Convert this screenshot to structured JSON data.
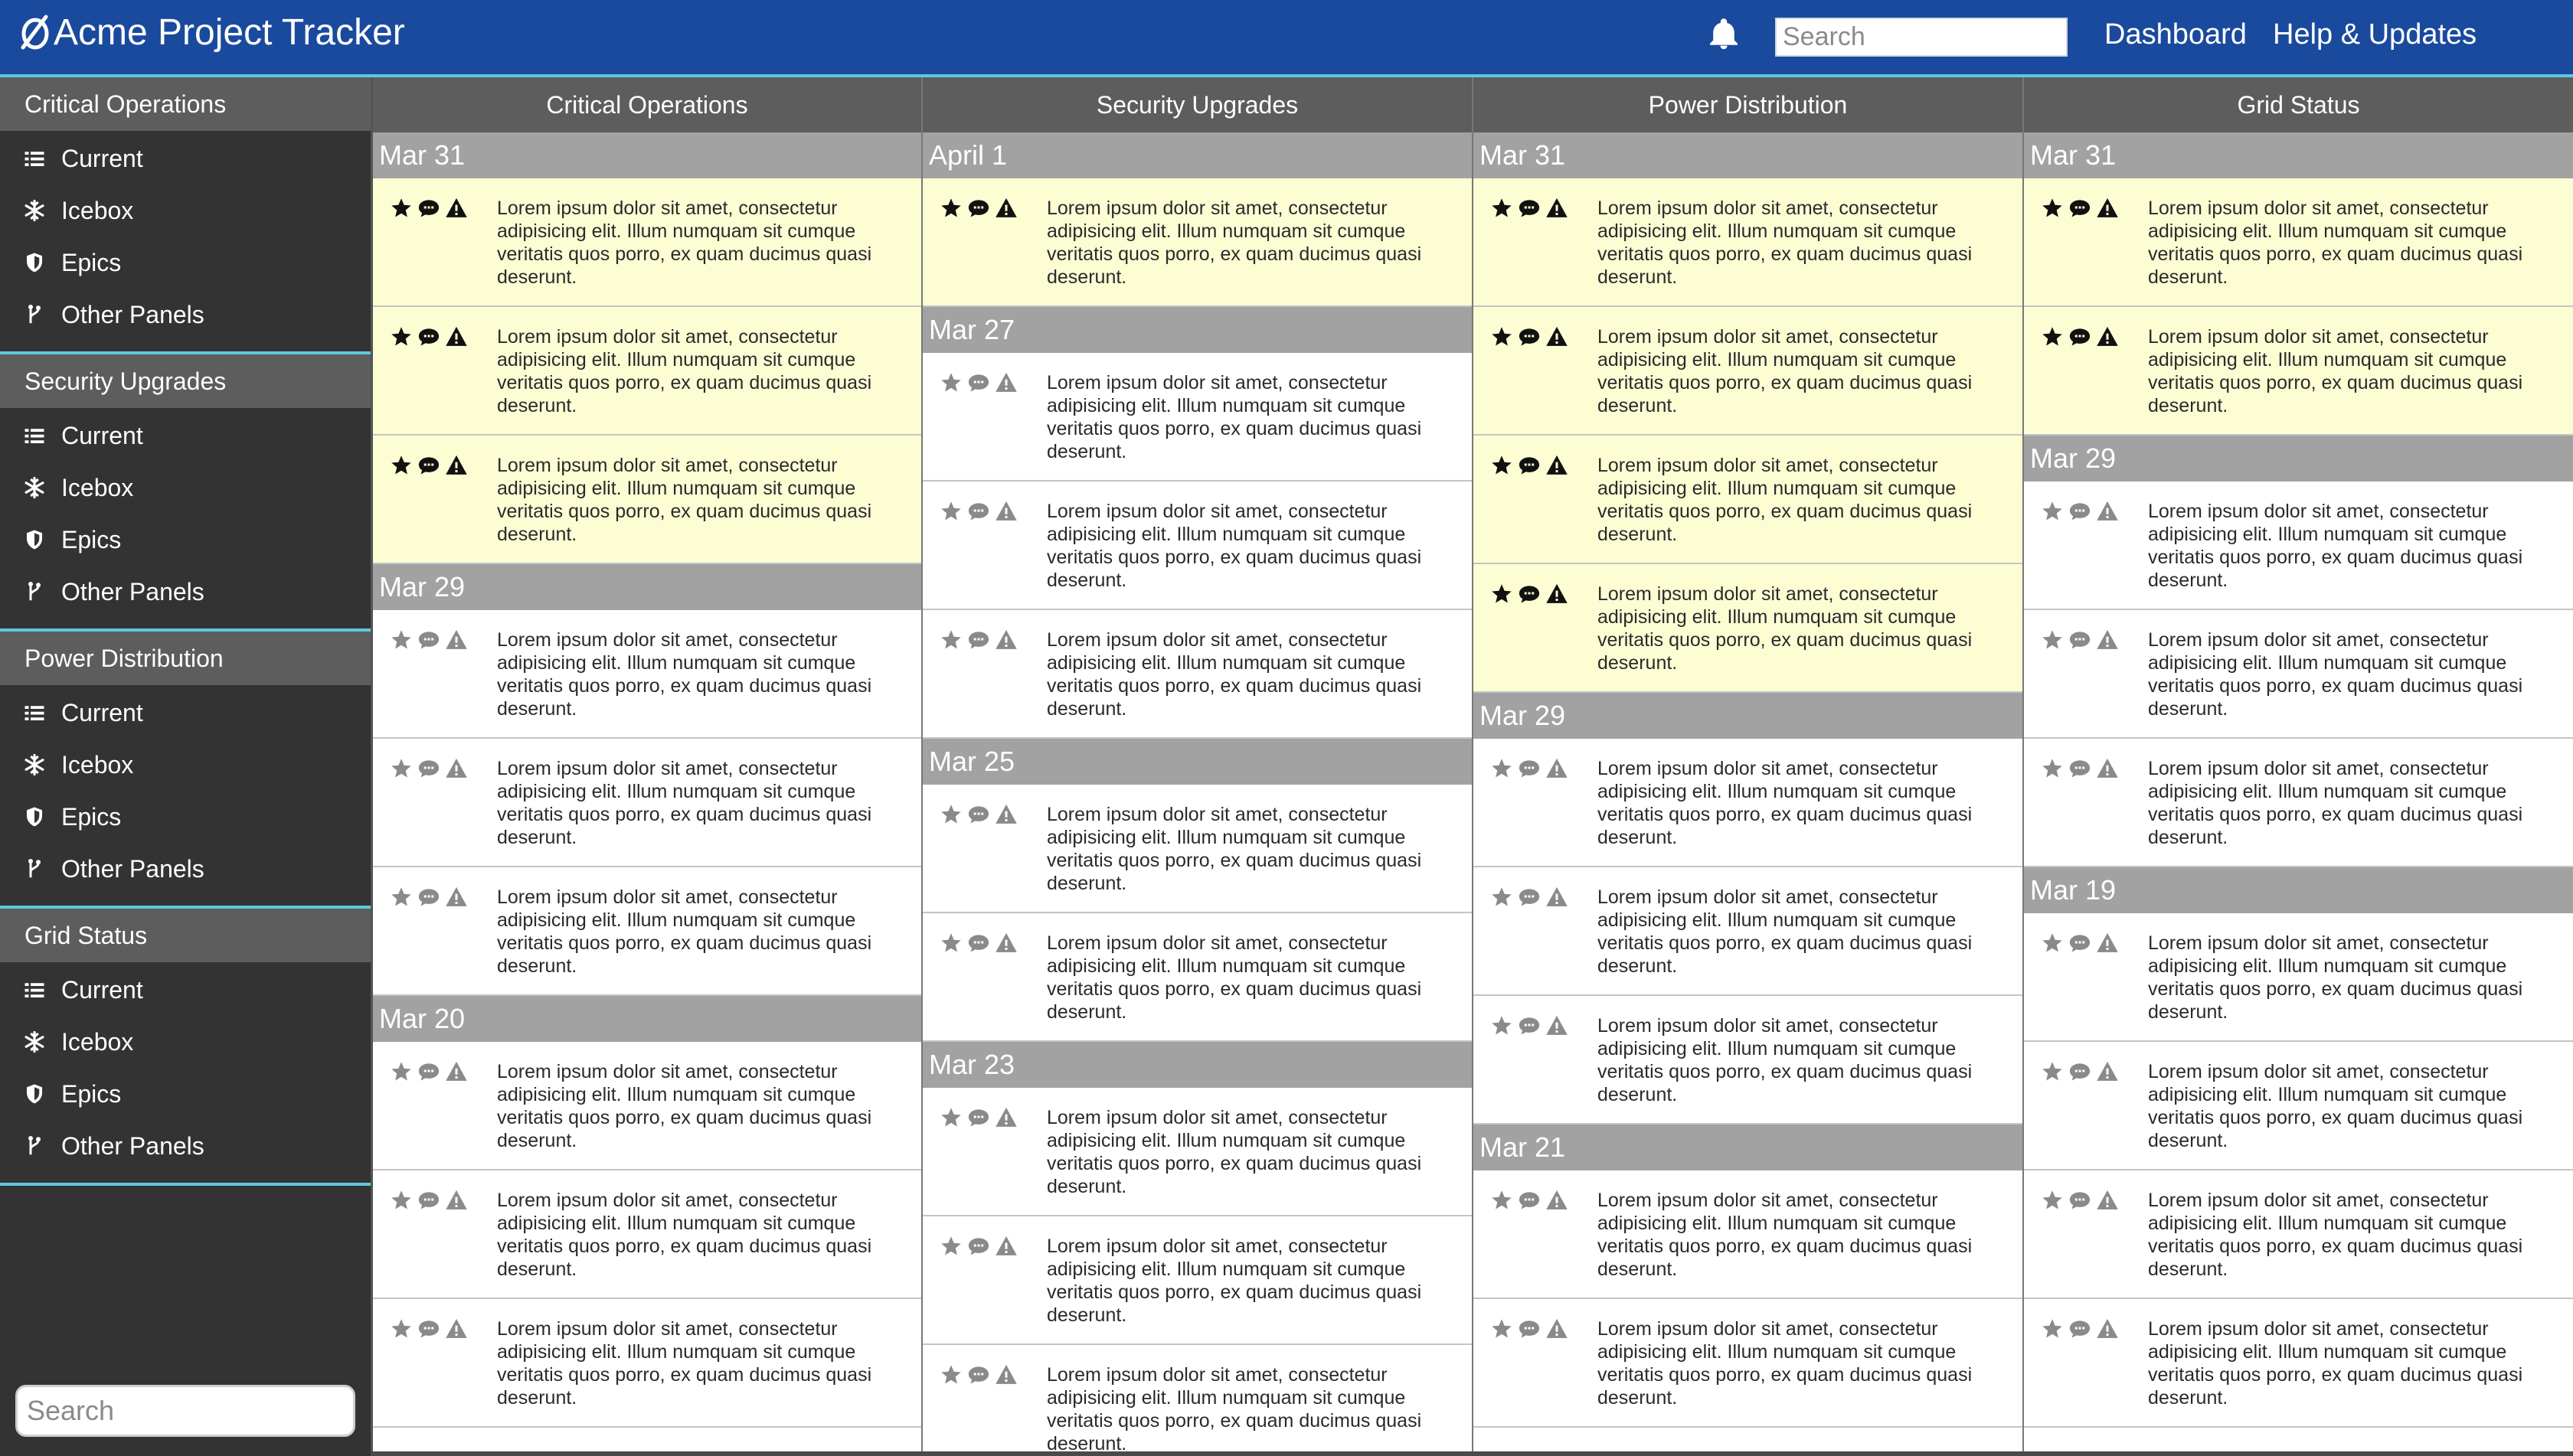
{
  "app": {
    "title": "Acme Project Tracker"
  },
  "topbar": {
    "search_placeholder": "Search",
    "links": [
      "Dashboard",
      "Help & Updates"
    ],
    "accent": "#5fc8e0",
    "background": "#1a4a9e"
  },
  "sidebar": {
    "groups": [
      {
        "title": "Critical Operations",
        "items": [
          "Current",
          "Icebox",
          "Epics",
          "Other Panels"
        ]
      },
      {
        "title": "Security Upgrades",
        "items": [
          "Current",
          "Icebox",
          "Epics",
          "Other Panels"
        ]
      },
      {
        "title": "Power Distribution",
        "items": [
          "Current",
          "Icebox",
          "Epics",
          "Other Panels"
        ]
      },
      {
        "title": "Grid Status",
        "items": [
          "Current",
          "Icebox",
          "Epics",
          "Other Panels"
        ]
      }
    ],
    "item_icons": [
      "list-icon",
      "snowflake-icon",
      "shield-icon",
      "branch-icon"
    ],
    "search_placeholder": "Search"
  },
  "card_text": "Lorem ipsum dolor sit amet, consectetur adipisicing elit. Illum numquam sit cumque veritatis quos porro, ex quam ducimus quasi deserunt.",
  "card_icons": [
    "star-icon",
    "comment-icon",
    "warning-icon"
  ],
  "highlight_color": "#fdfdd4",
  "columns": [
    {
      "title": "Critical Operations",
      "groups": [
        {
          "date": "Mar 31",
          "cards": 3,
          "highlighted": 3
        },
        {
          "date": "Mar 29",
          "cards": 3,
          "highlighted": 0
        },
        {
          "date": "Mar 20",
          "cards": 3,
          "highlighted": 0
        }
      ]
    },
    {
      "title": "Security Upgrades",
      "groups": [
        {
          "date": "April 1",
          "cards": 1,
          "highlighted": 1
        },
        {
          "date": "Mar 27",
          "cards": 3,
          "highlighted": 0
        },
        {
          "date": "Mar 25",
          "cards": 2,
          "highlighted": 0
        },
        {
          "date": "Mar 23",
          "cards": 3,
          "highlighted": 0
        }
      ]
    },
    {
      "title": "Power Distribution",
      "groups": [
        {
          "date": "Mar 31",
          "cards": 4,
          "highlighted": 4
        },
        {
          "date": "Mar 29",
          "cards": 3,
          "highlighted": 0
        },
        {
          "date": "Mar 21",
          "cards": 2,
          "highlighted": 0
        }
      ]
    },
    {
      "title": "Grid Status",
      "groups": [
        {
          "date": "Mar 31",
          "cards": 2,
          "highlighted": 2
        },
        {
          "date": "Mar 29",
          "cards": 3,
          "highlighted": 0
        },
        {
          "date": "Mar 19",
          "cards": 4,
          "highlighted": 0
        }
      ]
    }
  ]
}
